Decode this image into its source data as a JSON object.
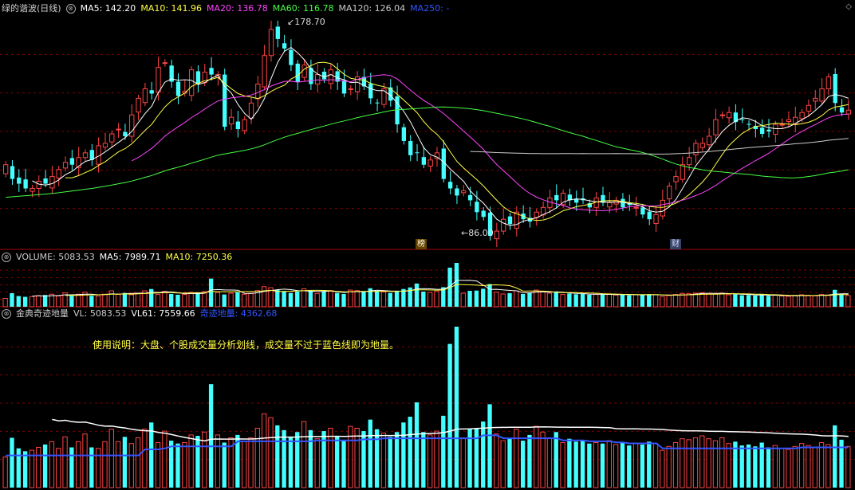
{
  "price_panel": {
    "title": "绿的谐波(日线)",
    "ma_labels": [
      {
        "text": "MA5: 142.20",
        "color": "#ffffff"
      },
      {
        "text": "MA10: 141.96",
        "color": "#ffff44"
      },
      {
        "text": "MA20: 136.78",
        "color": "#ff44ff"
      },
      {
        "text": "MA60: 116.78",
        "color": "#44ff44"
      },
      {
        "text": "MA120: 126.04",
        "color": "#cccccc"
      },
      {
        "text": "MA250: -",
        "color": "#3355ff"
      }
    ],
    "high_label": "178.70",
    "low_label": "86.00",
    "event_tags": [
      "榜",
      "财"
    ]
  },
  "volume_panel": {
    "labels": [
      {
        "text": "VOLUME: 5083.53",
        "color": "#cccccc"
      },
      {
        "text": "MA5: 7989.71",
        "color": "#ffffff"
      },
      {
        "text": "MA10: 7250.36",
        "color": "#ffff44"
      }
    ]
  },
  "indicator_panel": {
    "labels": [
      {
        "text": "金典奇迹地量",
        "color": "#cccccc"
      },
      {
        "text": "VL: 5083.53",
        "color": "#cccccc"
      },
      {
        "text": "VL61: 7559.66",
        "color": "#ffffff"
      },
      {
        "text": "奇迹地量: 4362.68",
        "color": "#3355ff"
      }
    ],
    "note": "使用说明：大盘、个股成交量分析划线，成交量不过于蓝色线即为地量。"
  },
  "colors": {
    "up": "#ff4444",
    "down": "#44ffff",
    "bg": "#000000",
    "grid": "#800000"
  },
  "chart_data": {
    "type": "candlestick",
    "price_range": [
      86.0,
      178.7
    ],
    "series": [
      {
        "name": "MA5",
        "color": "#ffffff"
      },
      {
        "name": "MA10",
        "color": "#ffff44"
      },
      {
        "name": "MA20",
        "color": "#ff44ff"
      },
      {
        "name": "MA60",
        "color": "#44ff44"
      },
      {
        "name": "MA120",
        "color": "#cccccc"
      }
    ],
    "close": [
      118,
      112,
      110,
      108,
      108,
      111,
      110,
      113,
      116,
      119,
      118,
      121,
      123,
      120,
      126,
      127,
      131,
      133,
      130,
      139,
      146,
      150,
      148,
      159,
      161,
      153,
      147,
      149,
      158,
      152,
      157,
      156,
      156,
      134,
      138,
      133,
      137,
      144,
      152,
      164,
      175,
      171,
      167,
      160,
      153,
      160,
      152,
      156,
      154,
      158,
      153,
      148,
      150,
      155,
      151,
      146,
      144,
      150,
      145,
      135,
      128,
      122,
      123,
      118,
      120,
      123,
      112,
      108,
      105,
      107,
      103,
      98,
      96,
      88,
      90,
      95,
      93,
      98,
      95,
      94,
      98,
      100,
      104,
      103,
      106,
      103,
      102,
      103,
      100,
      104,
      102,
      102,
      103,
      100,
      101,
      100,
      97,
      95,
      97,
      103,
      109,
      113,
      118,
      121,
      127,
      127,
      130,
      137,
      139,
      140,
      136,
      137,
      135,
      133,
      131,
      132,
      135,
      135,
      137,
      138,
      140,
      143,
      146,
      150,
      155,
      144,
      140,
      141
    ],
    "volume": [
      3200,
      5200,
      4100,
      3800,
      3900,
      4200,
      4500,
      4800,
      4100,
      5300,
      4200,
      4800,
      5600,
      4200,
      4100,
      4800,
      6100,
      4800,
      5300,
      4600,
      5200,
      6100,
      6800,
      4700,
      5900,
      4900,
      4600,
      4700,
      5500,
      5400,
      5800,
      10800,
      5500,
      4700,
      5200,
      5500,
      4800,
      5200,
      6200,
      7700,
      7300,
      6500,
      6000,
      5300,
      5800,
      6900,
      6000,
      5100,
      5900,
      6200,
      5300,
      4900,
      6400,
      6200,
      5900,
      7100,
      6100,
      5700,
      5300,
      5800,
      6800,
      7400,
      8900,
      5800,
      5500,
      5900,
      7500,
      15000,
      16800,
      5200,
      6100,
      6200,
      6900,
      8700,
      5600,
      4900,
      5200,
      6100,
      4900,
      5500,
      6400,
      5800,
      5200,
      5800,
      4700,
      5100,
      4800,
      4900,
      4600,
      4700,
      4600,
      4900,
      4500,
      4700,
      4400,
      4600,
      4500,
      4800,
      4600,
      3900,
      4300,
      4700,
      5100,
      5000,
      5200,
      5400,
      5100,
      4900,
      5200,
      4600,
      4800,
      4400,
      4500,
      4300,
      4700,
      4200,
      4400,
      4100,
      4000,
      4300,
      4600,
      4400,
      4200,
      4700,
      4500,
      6500,
      5000,
      4300
    ],
    "vl61": [
      null,
      null,
      null,
      null,
      null,
      null,
      null,
      null,
      null,
      null,
      null,
      null,
      null,
      null,
      null,
      null,
      null,
      null,
      null,
      null,
      null,
      null,
      null,
      null,
      null,
      null,
      null,
      null,
      null,
      null,
      null,
      null,
      null,
      null,
      null,
      null,
      null,
      null,
      null,
      null,
      null,
      null,
      null,
      null,
      null,
      null,
      null,
      null,
      null,
      null,
      null,
      null,
      null,
      null,
      null,
      null,
      null,
      null,
      null,
      null,
      null,
      null,
      null,
      null,
      null,
      null,
      null,
      null,
      null,
      null,
      null,
      null,
      null,
      null,
      null,
      null,
      null,
      null,
      null,
      null,
      null,
      null,
      null,
      null,
      null,
      null,
      null,
      null,
      null,
      null,
      null,
      null,
      null,
      null,
      null,
      null,
      null,
      null,
      null,
      null,
      null,
      null,
      null,
      null,
      null,
      null,
      null,
      null,
      null,
      null,
      null,
      null,
      null,
      null,
      null,
      null,
      null,
      null,
      null,
      null,
      null,
      null,
      null,
      null,
      null,
      null,
      null,
      null
    ],
    "last": {
      "vl": 5083.53,
      "vl61": 7559.66,
      "dl": 4362.68
    }
  }
}
